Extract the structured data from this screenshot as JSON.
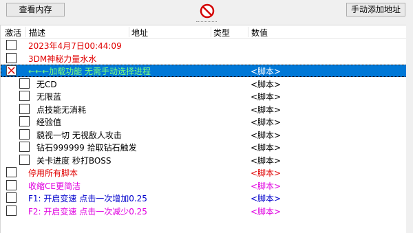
{
  "toolbar": {
    "memory_button": "查看内存",
    "add_address_button": "手动添加地址",
    "stop_icon": "no-entry-icon",
    "stop_color": "#d40000"
  },
  "columns": {
    "active": "激活",
    "description": "描述",
    "address": "地址",
    "type": "类型",
    "value": "数值"
  },
  "colors": {
    "red": "#e00000",
    "magenta": "#e000e0",
    "blue": "#0000cc",
    "green_selected": "#7cff7c",
    "selection": "#0078d7"
  },
  "rows": [
    {
      "description": "2023年4月7日00:44:09",
      "value": "",
      "color": "#e00000",
      "indent": 0,
      "checked": false,
      "selected": false
    },
    {
      "description": "3DM神秘力量水水",
      "value": "",
      "color": "#e00000",
      "indent": 0,
      "checked": false,
      "selected": false
    },
    {
      "description": "←←←加载功能  无需手动选择进程",
      "value": "<脚本>",
      "color": "#7cff7c",
      "value_color": "#ffffff",
      "indent": 0,
      "checked": true,
      "selected": true
    },
    {
      "description": "无CD",
      "value": "<脚本>",
      "color": "#000000",
      "indent": 1,
      "checked": false,
      "selected": false
    },
    {
      "description": "无限蓝",
      "value": "<脚本>",
      "color": "#000000",
      "indent": 1,
      "checked": false,
      "selected": false
    },
    {
      "description": "点技能无消耗",
      "value": "<脚本>",
      "color": "#000000",
      "indent": 1,
      "checked": false,
      "selected": false
    },
    {
      "description": "经验值",
      "value": "<脚本>",
      "color": "#000000",
      "indent": 1,
      "checked": false,
      "selected": false
    },
    {
      "description": "藐视一切 无视敌人攻击",
      "value": "<脚本>",
      "color": "#000000",
      "indent": 1,
      "checked": false,
      "selected": false
    },
    {
      "description": "钻石999999 拾取钻石触发",
      "value": "<脚本>",
      "color": "#000000",
      "indent": 1,
      "checked": false,
      "selected": false
    },
    {
      "description": "关卡进度 秒打BOSS",
      "value": "<脚本>",
      "color": "#000000",
      "indent": 1,
      "checked": false,
      "selected": false
    },
    {
      "description": "停用所有脚本",
      "value": "<脚本>",
      "color": "#e00000",
      "indent": 0,
      "checked": false,
      "selected": false
    },
    {
      "description": "收缩CE更简洁",
      "value": "<脚本>",
      "color": "#e000e0",
      "indent": 0,
      "checked": false,
      "selected": false
    },
    {
      "description": "F1: 开启变速 点击一次增加0.25",
      "value": "<脚本>",
      "color": "#0000cc",
      "indent": 0,
      "checked": false,
      "selected": false
    },
    {
      "description": "F2: 开启变速 点击一次减少0.25",
      "value": "<脚本>",
      "color": "#e000e0",
      "indent": 0,
      "checked": false,
      "selected": false
    }
  ]
}
